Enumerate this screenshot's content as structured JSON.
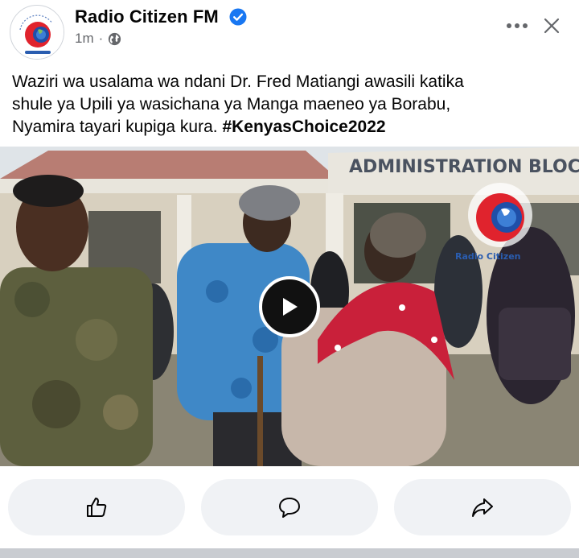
{
  "post": {
    "page_name": "Radio Citizen FM",
    "verified_icon": "verified-badge-icon",
    "time": "1m",
    "separator": "·",
    "audience_icon": "globe-icon",
    "text_lines": [
      "Waziri wa usalama wa ndani Dr. Fred Matiangi awasili katika",
      "shule ya Upili ya wasichana ya Manga maeneo ya Borabu,",
      "Nyamira tayari kupiga kura."
    ],
    "hashtag": "#KenyasChoice2022"
  },
  "media": {
    "type": "video",
    "sign_text": "ADMINISTRATION BLOC",
    "watermark_icon": "radio-citizen-logo",
    "watermark_text": "Radio Citizen",
    "play_icon": "play-icon"
  },
  "actions": {
    "like_icon": "thumbs-up-icon",
    "comment_icon": "comment-icon",
    "share_icon": "share-icon"
  },
  "colors": {
    "brand_blue": "#1877f2",
    "logo_red": "#e0232d",
    "action_bg": "#f0f2f5",
    "meta_gray": "#65676b"
  }
}
